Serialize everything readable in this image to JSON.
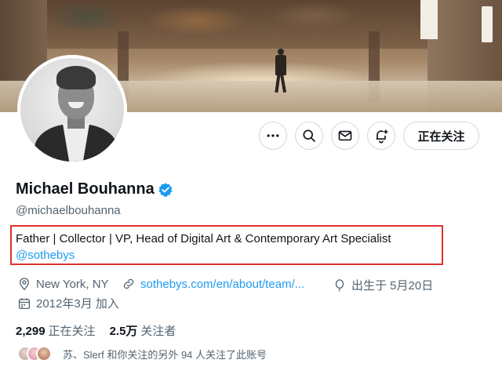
{
  "profile": {
    "name": "Michael Bouhanna",
    "handle": "@michaelbouhanna",
    "bio": "Father | Collector | VP, Head of Digital Art & Contemporary Art Specialist",
    "bio_link": "@sothebys",
    "location": "New York, NY",
    "website": "sothebys.com/en/about/team/...",
    "birthday": "出生于 5月20日",
    "joined": "2012年3月 加入"
  },
  "actions": {
    "more_icon": "more-horizontal-icon",
    "search_icon": "search-icon",
    "message_icon": "mail-icon",
    "notify_icon": "bell-plus-icon",
    "follow_label": "正在关注"
  },
  "stats": {
    "following_count": "2,299",
    "following_label": "正在关注",
    "followers_count": "2.5万",
    "followers_label": "关注者"
  },
  "followers_you_know": {
    "text": "苏、Slerf 和你关注的另外 94 人关注了此账号"
  },
  "colors": {
    "accent": "#1d9bf0",
    "text": "#0f1419",
    "secondary": "#536471",
    "highlight_border": "#e03030"
  }
}
